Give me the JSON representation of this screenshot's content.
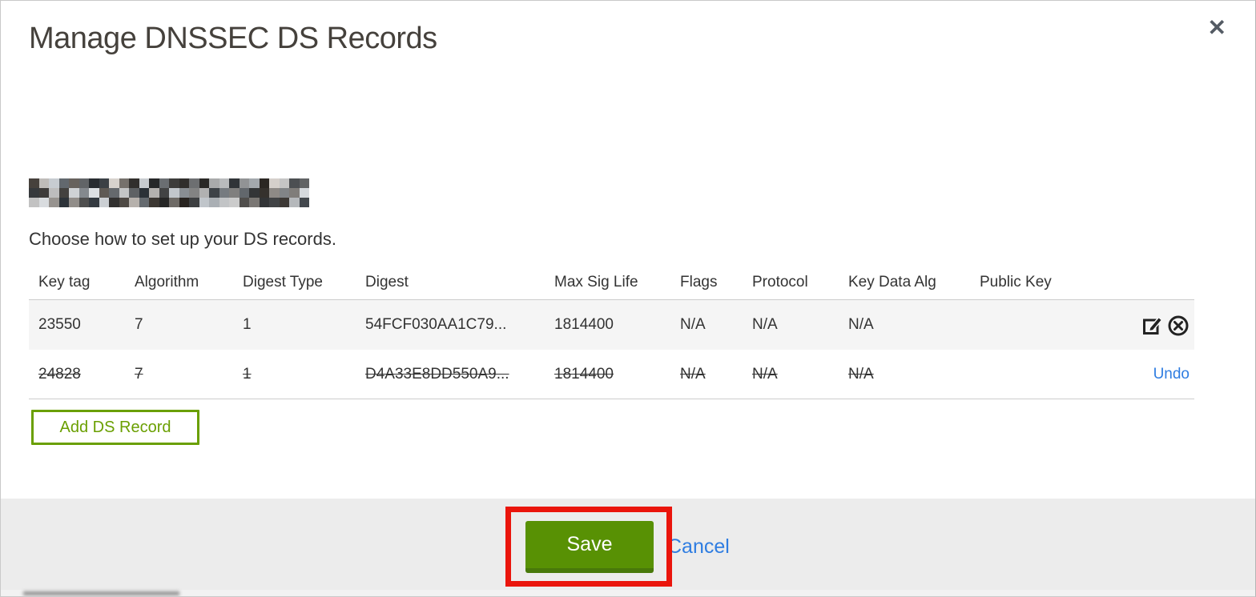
{
  "modal": {
    "title": "Manage DNSSEC DS Records",
    "close_glyph": "✕",
    "subtitle": "Choose how to set up your DS records."
  },
  "table": {
    "columns": {
      "key_tag": "Key tag",
      "algorithm": "Algorithm",
      "digest_type": "Digest Type",
      "digest": "Digest",
      "max_sig_life": "Max Sig Life",
      "flags": "Flags",
      "protocol": "Protocol",
      "key_data_alg": "Key Data Alg",
      "public_key": "Public Key"
    },
    "rows": [
      {
        "key_tag": "23550",
        "algorithm": "7",
        "digest_type": "1",
        "digest": "54FCF030AA1C79...",
        "max_sig_life": "1814400",
        "flags": "N/A",
        "protocol": "N/A",
        "key_data_alg": "N/A",
        "public_key": "",
        "state": "active",
        "actions": [
          "edit-icon",
          "remove-icon"
        ]
      },
      {
        "key_tag": "24828",
        "algorithm": "7",
        "digest_type": "1",
        "digest": "D4A33E8DD550A9...",
        "max_sig_life": "1814400",
        "flags": "N/A",
        "protocol": "N/A",
        "key_data_alg": "N/A",
        "public_key": "",
        "state": "deleted",
        "undo_label": "Undo"
      }
    ]
  },
  "buttons": {
    "add_ds_record": "Add DS Record",
    "save": "Save",
    "cancel": "Cancel"
  },
  "annotation": {
    "type": "red-rectangle-highlight",
    "target": "save-button",
    "color": "#ea150c"
  },
  "colors": {
    "save_green": "#589104",
    "save_green_dark": "#48790a",
    "outline_green": "#6a9f01",
    "link_blue": "#2f7de1",
    "footer_bg": "#ececec",
    "row_bg": "#f5f5f5",
    "text": "#333333",
    "title_text": "#45413c"
  }
}
